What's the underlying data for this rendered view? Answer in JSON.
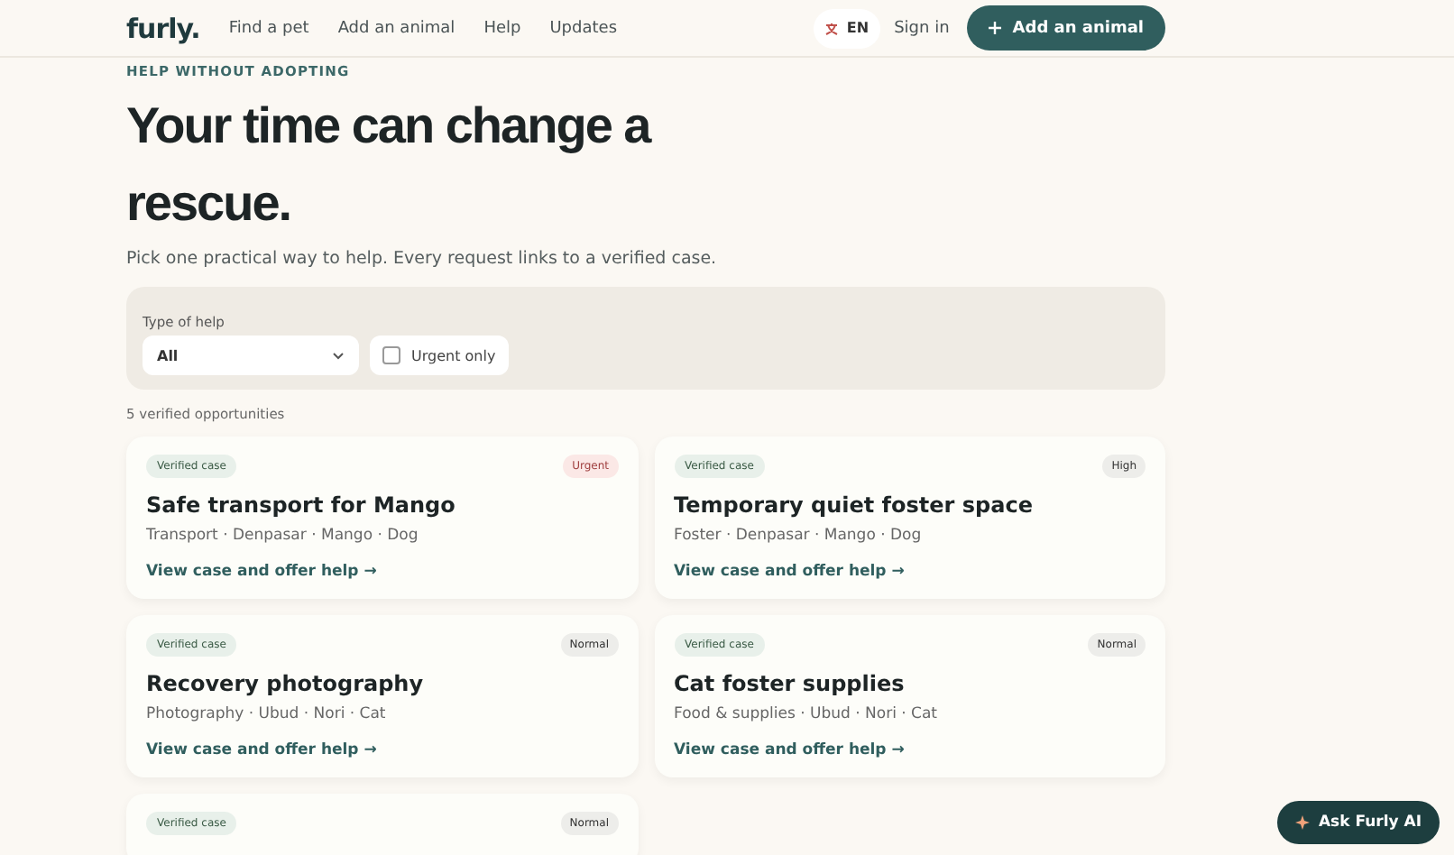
{
  "header": {
    "logo": "furly.",
    "nav": [
      {
        "label": "Find a pet"
      },
      {
        "label": "Add an animal"
      },
      {
        "label": "Help"
      },
      {
        "label": "Updates"
      }
    ],
    "language": "EN",
    "sign_in": "Sign in",
    "cta": "Add an animal"
  },
  "eyebrow": "HELP WITHOUT ADOPTING",
  "title": "Your time can change a rescue.",
  "intro": "Pick one practical way to help. Every request links to a verified case.",
  "filters": {
    "type_label": "Type of help",
    "type_value": "All",
    "urgent": {
      "label": "Urgent only",
      "checked": false
    }
  },
  "count": "5 verified opportunities",
  "cards": [
    {
      "verified": "Verified case",
      "priority": "Urgent",
      "kind": "urgent",
      "title": "Safe transport for Mango",
      "meta": "Transport · Denpasar · Mango · Dog",
      "link": "View case and offer help →"
    },
    {
      "verified": "Verified case",
      "priority": "High",
      "kind": "high",
      "title": "Temporary quiet foster space",
      "meta": "Foster · Denpasar · Mango · Dog",
      "link": "View case and offer help →"
    },
    {
      "verified": "Verified case",
      "priority": "Normal",
      "kind": "normal",
      "title": "Recovery photography",
      "meta": "Photography · Ubud · Nori · Cat",
      "link": "View case and offer help →"
    },
    {
      "verified": "Verified case",
      "priority": "Normal",
      "kind": "normal",
      "title": "Cat foster supplies",
      "meta": "Food & supplies · Ubud · Nori · Cat",
      "link": "View case and offer help →"
    },
    {
      "verified": "Verified case",
      "priority": "Normal",
      "kind": "normal"
    }
  ],
  "assistant": "Ask Furly AI"
}
